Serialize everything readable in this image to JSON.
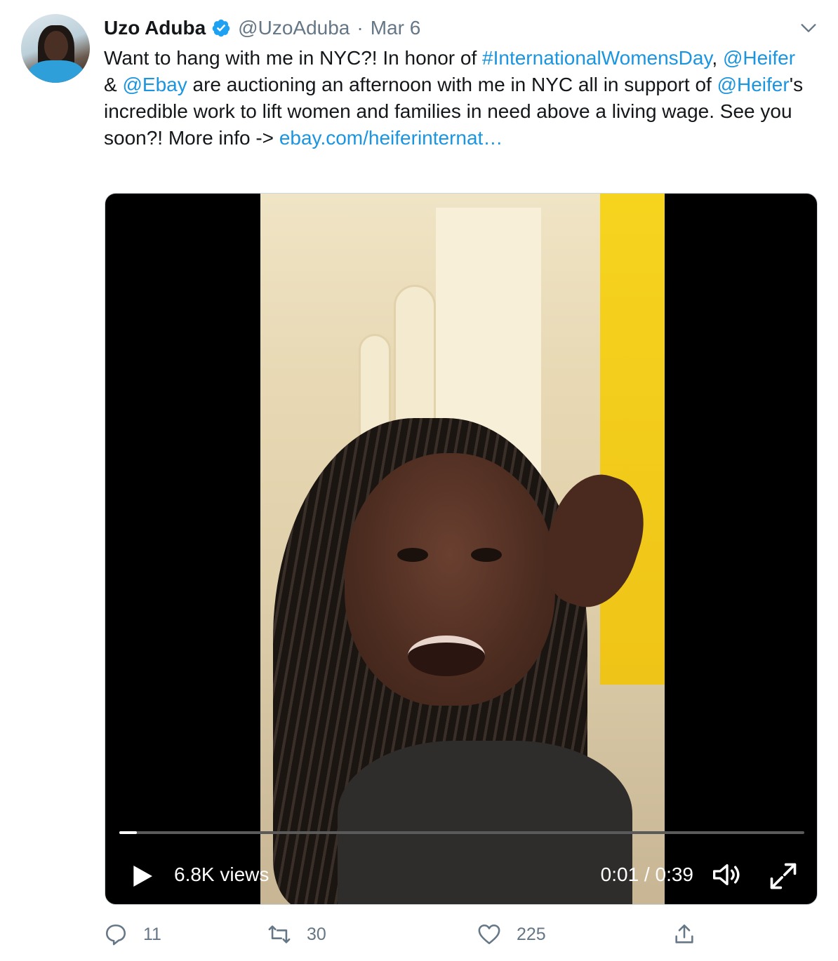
{
  "tweet": {
    "author_name": "Uzo Aduba",
    "handle": "@UzoAduba",
    "separator": "·",
    "date": "Mar 6",
    "text": [
      {
        "t": "Want to hang with me in NYC?! In honor of ",
        "link": false
      },
      {
        "t": "#InternationalWomensDay",
        "link": true
      },
      {
        "t": ", ",
        "link": false
      },
      {
        "t": "@Heifer",
        "link": true
      },
      {
        "t": " & ",
        "link": false
      },
      {
        "t": "@Ebay",
        "link": true
      },
      {
        "t": " are auctioning an afternoon with me in NYC all in support of ",
        "link": false
      },
      {
        "t": "@Heifer",
        "link": true
      },
      {
        "t": "'s incredible work to lift women and families in need above a living wage. See you soon?! More info -> ",
        "link": false
      },
      {
        "t": "ebay.com/heiferinternat…",
        "link": true
      }
    ]
  },
  "video": {
    "views": "6.8K views",
    "time": "0:01 / 0:39",
    "progress_fraction": 0.026
  },
  "actions": {
    "replies": "11",
    "retweets": "30",
    "likes": "225"
  },
  "colors": {
    "link": "#1b95e0",
    "secondary_text": "#657786",
    "verified_badge": "#1da1f2"
  },
  "icons": [
    "verified-badge-icon",
    "caret-down-icon",
    "play-icon",
    "volume-icon",
    "fullscreen-icon",
    "reply-icon",
    "retweet-icon",
    "like-icon",
    "share-icon"
  ]
}
